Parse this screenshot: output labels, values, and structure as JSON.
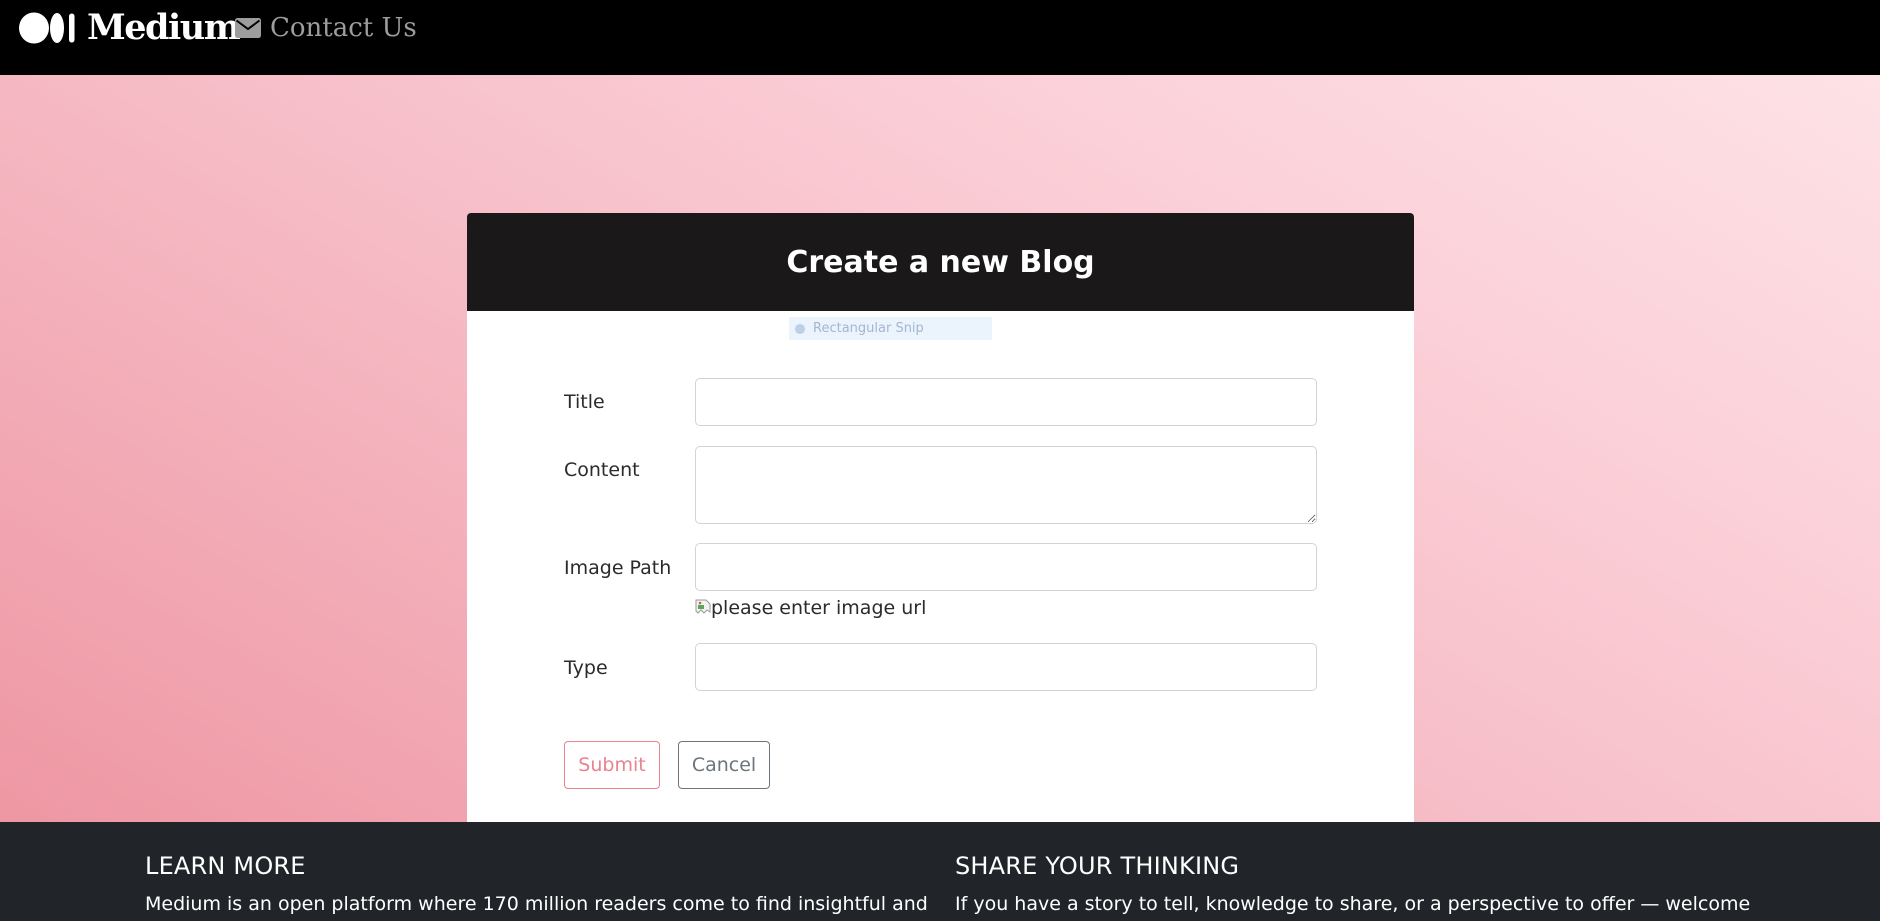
{
  "navbar": {
    "brand": "Medium",
    "contact_label": "Contact Us",
    "contact_icon": "envelope-icon",
    "background": "#000000"
  },
  "card": {
    "title": "Create a new Blog",
    "header_background": "#1a1819"
  },
  "overlay": {
    "label": "Rectangular Snip"
  },
  "form": {
    "title_label": "Title",
    "title_value": "",
    "content_label": "Content",
    "content_value": "",
    "image_path_label": "Image Path",
    "image_path_value": "",
    "image_alt": "please enter image url",
    "type_label": "Type",
    "type_value": ""
  },
  "buttons": {
    "submit": "Submit",
    "cancel": "Cancel",
    "submit_color": "#e8838f",
    "cancel_color": "#6c757d"
  },
  "footer": {
    "learn_more_heading": "LEARN MORE",
    "learn_more_text": "Medium is an open platform where 170 million readers come to find insightful and",
    "share_heading": "SHARE YOUR THINKING",
    "share_text": "If you have a story to tell, knowledge to share, or a perspective to offer — welcome",
    "background": "#212529"
  },
  "theme": {
    "hero_gradient_start": "#ee97a3",
    "hero_gradient_end": "#fde2e6"
  }
}
